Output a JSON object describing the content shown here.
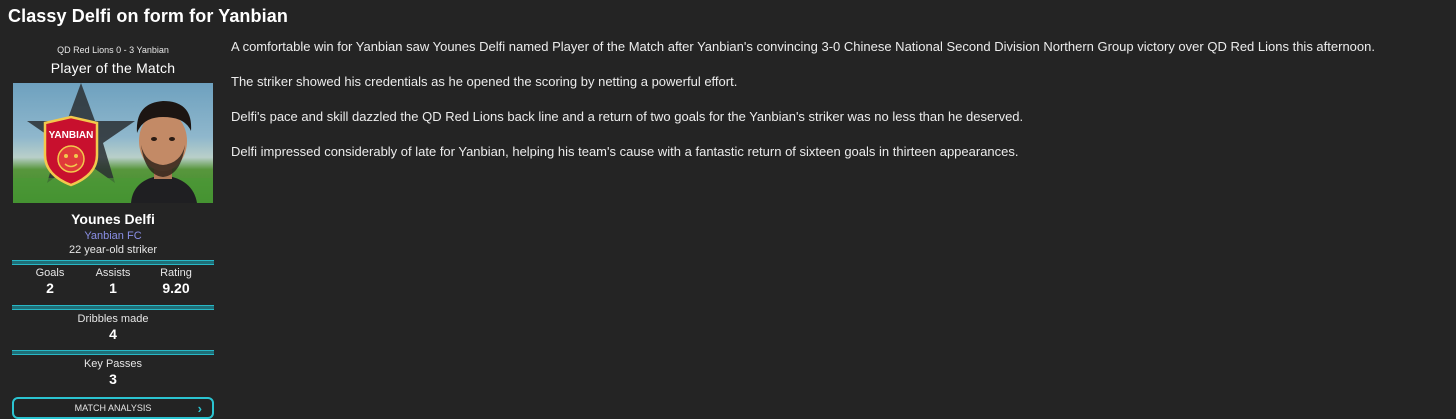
{
  "headline": "Classy Delfi on form for Yanbian",
  "panel": {
    "score_line": "QD Red Lions 0 - 3 Yanbian",
    "title": "Player of the Match",
    "badge_text": "YANBIAN",
    "player_name": "Younes Delfi",
    "club": "Yanbian FC",
    "age_position": "22 year-old striker",
    "stats": {
      "goals_label": "Goals",
      "goals_value": "2",
      "assists_label": "Assists",
      "assists_value": "1",
      "rating_label": "Rating",
      "rating_value": "9.20",
      "dribbles_label": "Dribbles made",
      "dribbles_value": "4",
      "key_passes_label": "Key Passes",
      "key_passes_value": "3"
    },
    "button_label": "MATCH ANALYSIS",
    "accent": "#2bc4d1",
    "club_color": "#8a8fe6"
  },
  "article": {
    "paragraphs": [
      "A comfortable win for Yanbian saw Younes Delfi named Player of the Match after Yanbian's convincing 3-0 Chinese National Second Division Northern Group victory over QD Red Lions this afternoon.",
      "The striker showed his credentials as he opened the scoring by netting a powerful effort.",
      "Delfi's pace and skill dazzled the QD Red Lions back line and a return of two goals for the Yanbian's striker was no less than he deserved.",
      "Delfi impressed considerably of late for Yanbian, helping his team's cause with a fantastic return of sixteen goals in thirteen appearances."
    ]
  }
}
